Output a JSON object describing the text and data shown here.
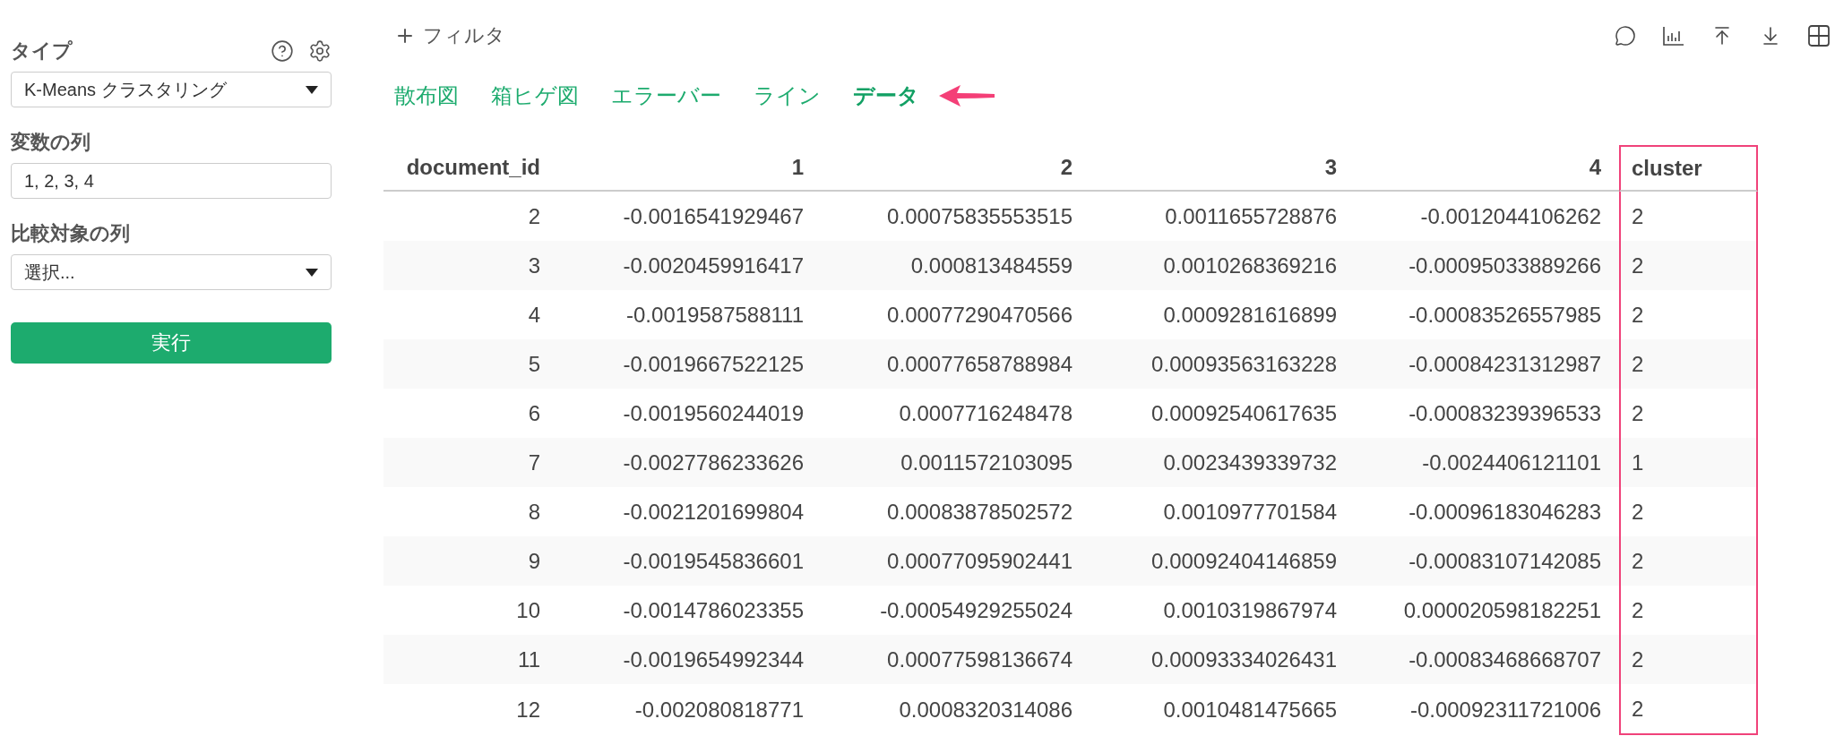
{
  "sidebar": {
    "fields": [
      {
        "kind": "select",
        "label": "タイプ",
        "value": "K-Means クラスタリング",
        "help": true
      },
      {
        "kind": "input",
        "label": "変数の列",
        "value": "1, 2, 3, 4"
      },
      {
        "kind": "select",
        "label": "比較対象の列",
        "value": "選択..."
      }
    ],
    "run_button": "実行"
  },
  "toolbar": {
    "filter_label": "フィルタ"
  },
  "tabs": [
    {
      "label": "散布図",
      "selected": false
    },
    {
      "label": "箱ヒゲ図",
      "selected": false
    },
    {
      "label": "エラーバー",
      "selected": false
    },
    {
      "label": "ライン",
      "selected": false
    },
    {
      "label": "データ",
      "selected": true
    }
  ],
  "table": {
    "columns": [
      {
        "label": "document_id",
        "highlighted": false
      },
      {
        "label": "1",
        "highlighted": false
      },
      {
        "label": "2",
        "highlighted": false
      },
      {
        "label": "3",
        "highlighted": false
      },
      {
        "label": "4",
        "highlighted": false
      },
      {
        "label": "cluster",
        "highlighted": true
      }
    ],
    "rows": [
      [
        "2",
        "-0.0016541929467",
        "0.00075835553515",
        "0.0011655728876",
        "-0.0012044106262",
        "2"
      ],
      [
        "3",
        "-0.0020459916417",
        "0.000813484559",
        "0.0010268369216",
        "-0.00095033889266",
        "2"
      ],
      [
        "4",
        "-0.0019587588111",
        "0.00077290470566",
        "0.0009281616899",
        "-0.00083526557985",
        "2"
      ],
      [
        "5",
        "-0.0019667522125",
        "0.00077658788984",
        "0.00093563163228",
        "-0.00084231312987",
        "2"
      ],
      [
        "6",
        "-0.0019560244019",
        "0.0007716248478",
        "0.00092540617635",
        "-0.00083239396533",
        "2"
      ],
      [
        "7",
        "-0.0027786233626",
        "0.0011572103095",
        "0.0023439339732",
        "-0.0024406121101",
        "1"
      ],
      [
        "8",
        "-0.0021201699804",
        "0.00083878502572",
        "0.0010977701584",
        "-0.00096183046283",
        "2"
      ],
      [
        "9",
        "-0.0019545836601",
        "0.00077095902441",
        "0.00092404146859",
        "-0.00083107142085",
        "2"
      ],
      [
        "10",
        "-0.0014786023355",
        "-0.00054929255024",
        "0.0010319867974",
        "0.000020598182251",
        "2"
      ],
      [
        "11",
        "-0.0019654992344",
        "0.00077598136674",
        "0.00093334026431",
        "-0.00083468668707",
        "2"
      ],
      [
        "12",
        "-0.002080818771",
        "0.0008320314086",
        "0.0010481475665",
        "-0.00092311721006",
        "2"
      ]
    ]
  }
}
